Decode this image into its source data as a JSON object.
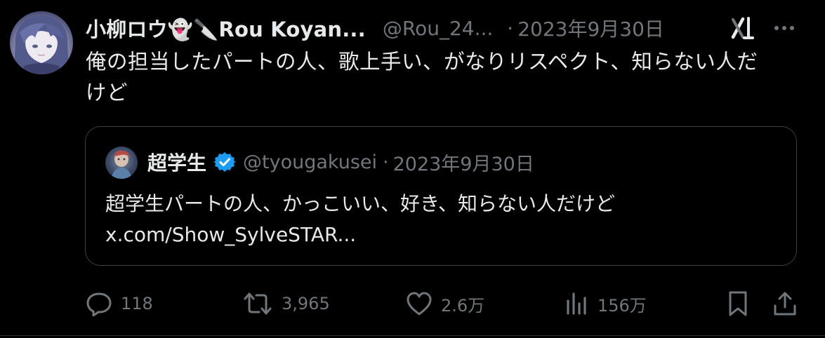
{
  "tweet": {
    "display_name": "小柳ロウ👻🔪Rou Koyan...",
    "handle": "@Rou_24...",
    "separator": "·",
    "date": "2023年9月30日",
    "text_line1": "俺の担当したパートの人、歌上手い、がなりリスペクト、知らない人だ",
    "text_line2": "けど"
  },
  "quoted": {
    "name": "超学生",
    "handle": "@tyougakusei",
    "separator": "·",
    "date": "2023年9月30日",
    "text_line1": "超学生パートの人、かっこいい、好き、知らない人だけど",
    "text_line2": "x.com/Show_SylveSTAR..."
  },
  "actions": {
    "reply_count": "118",
    "retweet_count": "3,965",
    "like_count": "2.6万",
    "view_count": "156万"
  },
  "icons": {
    "reply": "reply-icon",
    "retweet": "retweet-icon",
    "like": "heart-icon",
    "views": "bar-chart-icon",
    "bookmark": "bookmark-icon",
    "share": "share-icon",
    "grok": "grok-icon",
    "more": "more-icon",
    "verified": "verified-badge-icon"
  },
  "colors": {
    "background": "#000000",
    "text_primary": "#e7e9ea",
    "text_secondary": "#71767b",
    "verified_blue": "#1d9bf0",
    "border": "#3a3f44"
  }
}
